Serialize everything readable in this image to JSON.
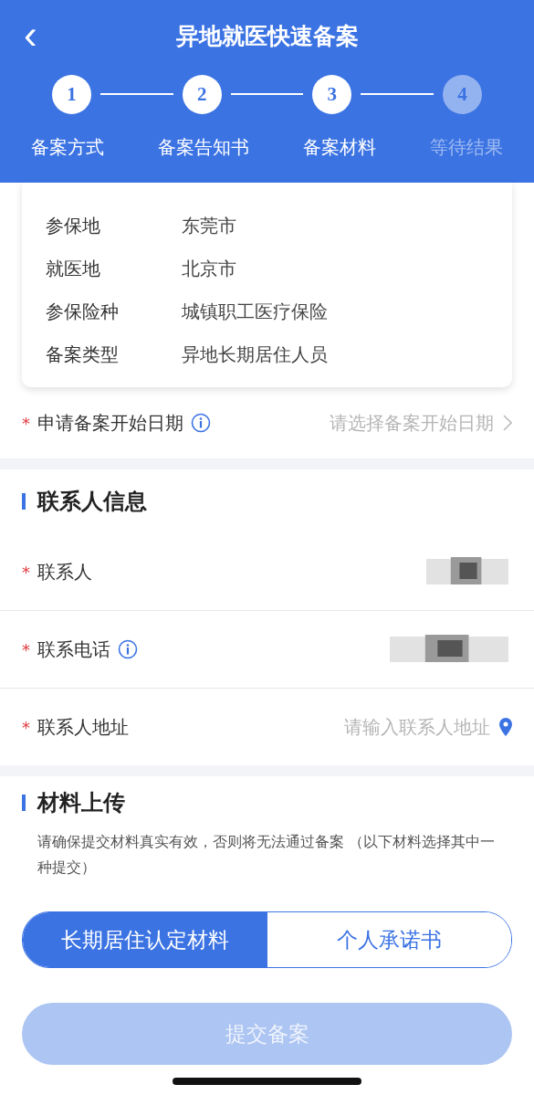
{
  "header": {
    "title": "异地就医快速备案",
    "back": "‹"
  },
  "steps": [
    {
      "number": "1",
      "label": "备案方式",
      "completed": true
    },
    {
      "number": "2",
      "label": "备案告知书",
      "completed": true
    },
    {
      "number": "3",
      "label": "备案材料",
      "completed": true
    },
    {
      "number": "4",
      "label": "等待结果",
      "completed": false
    }
  ],
  "info_card": {
    "rows": [
      {
        "label": "参保地",
        "value": "东莞市"
      },
      {
        "label": "就医地",
        "value": "北京市"
      },
      {
        "label": "参保险种",
        "value": "城镇职工医疗保险"
      },
      {
        "label": "备案类型",
        "value": "异地长期居住人员"
      }
    ]
  },
  "start_date": {
    "label": "申请备案开始日期",
    "required_mark": "*",
    "info": true,
    "kind": "select",
    "placeholder": "请选择备案开始日期"
  },
  "contact_section": {
    "title": "联系人信息",
    "fields": [
      {
        "label": "联系人",
        "required_mark": "*",
        "info": false,
        "kind": "redacted"
      },
      {
        "label": "联系电话",
        "required_mark": "*",
        "info": true,
        "kind": "redacted"
      },
      {
        "label": "联系人地址",
        "required_mark": "*",
        "info": false,
        "kind": "location",
        "placeholder": "请输入联系人地址"
      }
    ]
  },
  "materials_section": {
    "title": "材料上传",
    "note": "请确保提交材料真实有效，否则将无法通过备案 （以下材料选择其中一种提交）",
    "options": [
      {
        "label": "长期居住认定材料",
        "selected": true
      },
      {
        "label": "个人承诺书",
        "selected": false
      }
    ]
  },
  "submit": {
    "label": "提交备案",
    "disabled": true
  }
}
